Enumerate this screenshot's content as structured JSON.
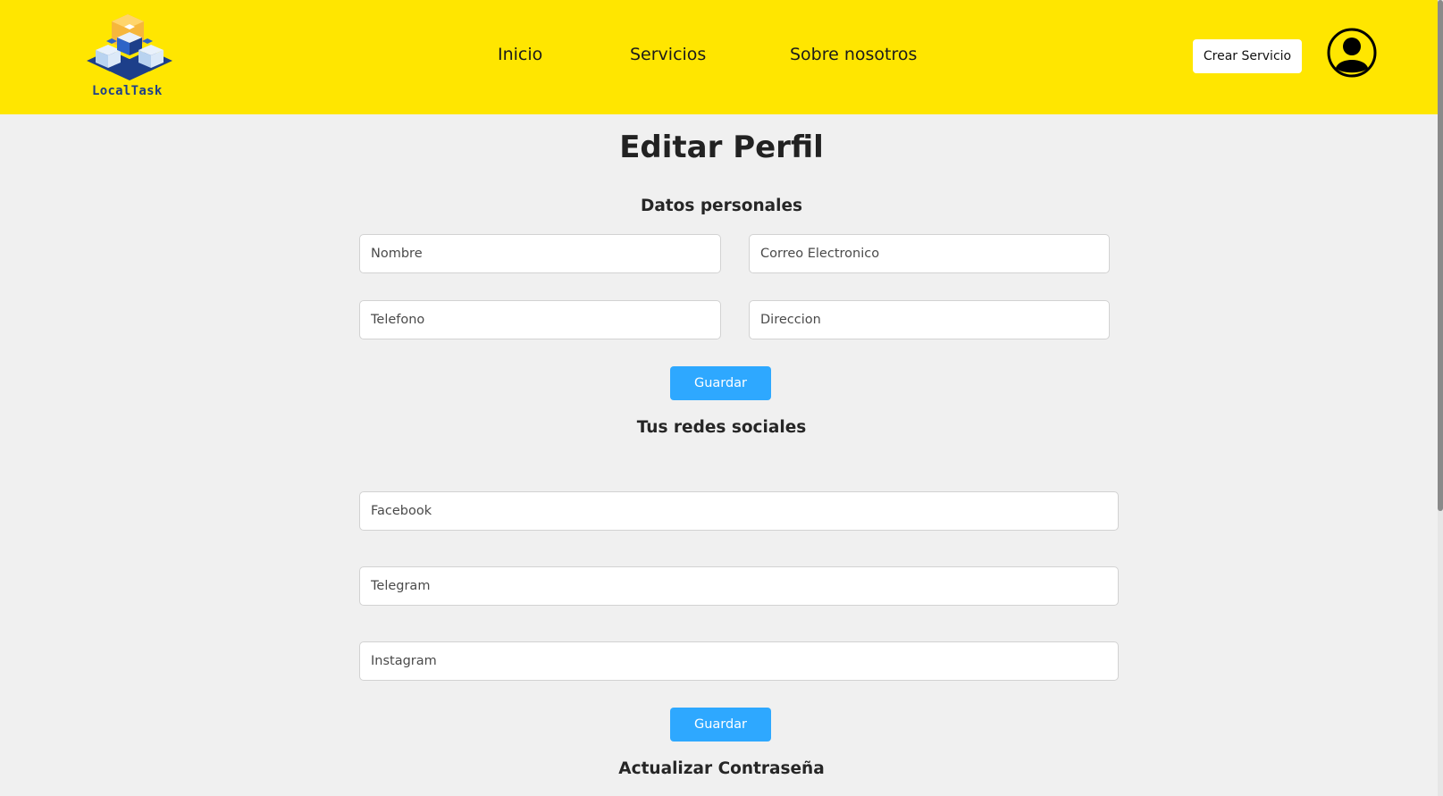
{
  "header": {
    "logo_text": "LocalTask",
    "nav": [
      {
        "label": "Inicio"
      },
      {
        "label": "Servicios"
      },
      {
        "label": "Sobre nosotros"
      }
    ],
    "create_button": "Crear Servicio",
    "colors": {
      "background": "#ffe600",
      "logo_text": "#1d3f8a"
    }
  },
  "page_title": "Editar Perfil",
  "personal": {
    "title": "Datos personales",
    "fields": {
      "name": {
        "placeholder": "Nombre"
      },
      "email": {
        "placeholder": "Correo Electronico"
      },
      "phone": {
        "placeholder": "Telefono"
      },
      "address": {
        "placeholder": "Direccion"
      }
    },
    "save_label": "Guardar"
  },
  "social": {
    "title": "Tus redes sociales",
    "fields": {
      "facebook": {
        "placeholder": "Facebook"
      },
      "telegram": {
        "placeholder": "Telegram"
      },
      "instagram": {
        "placeholder": "Instagram"
      }
    },
    "save_label": "Guardar"
  },
  "password": {
    "title": "Actualizar Contraseña"
  },
  "icons": [
    "localtask-logo-icon",
    "user-avatar-icon"
  ],
  "colors": {
    "accent": "#2ea8ff",
    "page_background": "#f0f0f0"
  }
}
